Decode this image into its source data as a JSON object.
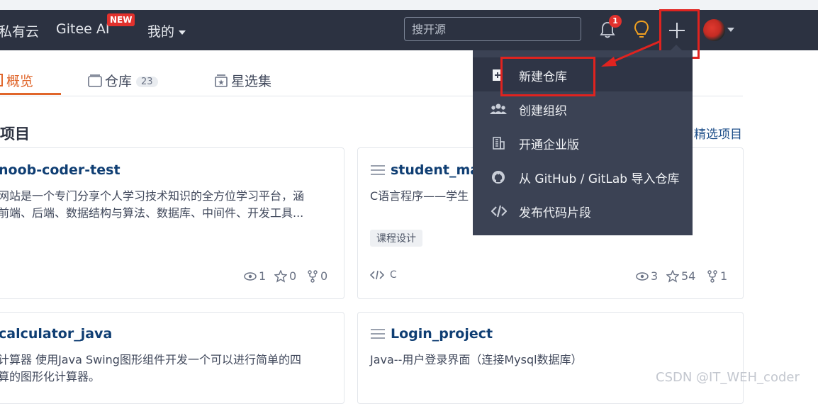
{
  "nav": {
    "brand_partial": "私有云",
    "gitee_ai": "Gitee AI",
    "new_badge": "NEW",
    "mine": "我的",
    "search_placeholder": "搜开源",
    "notification_count": "1",
    "plus_icon": "plus-icon",
    "accent_red": "#e0231f"
  },
  "tabs": [
    {
      "label": "概览",
      "active": true
    },
    {
      "label": "仓库",
      "count": "23"
    },
    {
      "label": "星选集"
    }
  ],
  "section": {
    "title_partial": "项目",
    "link_partial": "精选项目"
  },
  "cards": [
    {
      "title": "noob-coder-test",
      "desc_line1": "网站是一个专门分享个人学习技术知识的全方位学习平台，涵",
      "desc_line2": "前端、后端、数据结构与算法、数据库、中间件、开发工具...",
      "watch": "1",
      "star": "0",
      "fork": "0"
    },
    {
      "title": "student_mar",
      "desc_line1": "C语言程序——学生",
      "tag": "课程设计",
      "lang": "C",
      "watch": "3",
      "star": "54",
      "fork": "1"
    },
    {
      "title": "calculator_java",
      "desc_line1": "计算器 使用Java Swing图形组件开发一个可以进行简单的四",
      "desc_line2": "算的图形化计算器。"
    },
    {
      "title": "Login_project",
      "desc_line1": "Java--用户登录界面（连接Mysql数据库）"
    }
  ],
  "dropdown": {
    "items": [
      {
        "label": "新建仓库",
        "icon": "new-repo-icon"
      },
      {
        "label": "创建组织",
        "icon": "group-icon"
      },
      {
        "label": "开通企业版",
        "icon": "building-icon"
      },
      {
        "label": "从 GitHub / GitLab 导入仓库",
        "icon": "github-icon"
      },
      {
        "label": "发布代码片段",
        "icon": "code-icon"
      }
    ]
  },
  "watermark": "CSDN @IT_WEH_coder"
}
